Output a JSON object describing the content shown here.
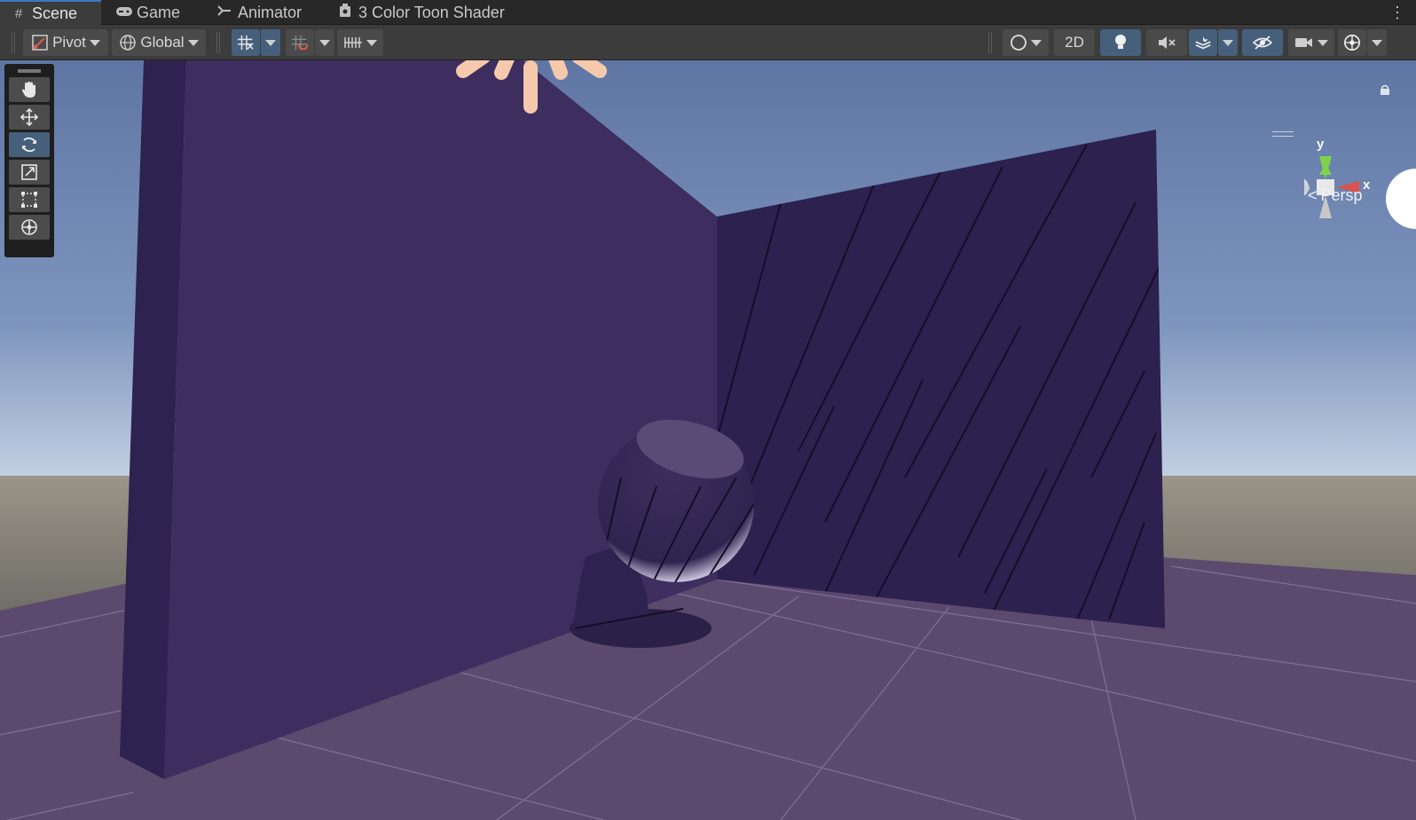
{
  "tabs": [
    {
      "label": "Scene",
      "icon": "scene-grid-icon",
      "active": true
    },
    {
      "label": "Game",
      "icon": "gamepad-icon",
      "active": false
    },
    {
      "label": "Animator",
      "icon": "animator-icon",
      "active": false
    },
    {
      "label": "3 Color Toon Shader",
      "icon": "shader-graph-icon",
      "active": false
    }
  ],
  "toolbar": {
    "pivot_label": "Pivot",
    "global_label": "Global",
    "mode_2d_label": "2D"
  },
  "tools": [
    {
      "name": "hand-tool",
      "icon": "hand-icon",
      "active": false
    },
    {
      "name": "move-tool",
      "icon": "move-arrows-icon",
      "active": false
    },
    {
      "name": "rotate-tool",
      "icon": "rotate-icon",
      "active": true
    },
    {
      "name": "scale-tool",
      "icon": "scale-icon",
      "active": false
    },
    {
      "name": "rect-tool",
      "icon": "rect-transform-icon",
      "active": false
    },
    {
      "name": "transform-tool",
      "icon": "transform-icon",
      "active": false
    }
  ],
  "gizmo": {
    "y_label": "y",
    "x_label": "x",
    "projection_label": "Persp"
  },
  "colors": {
    "accent": "#3a79bb",
    "active_button": "#46607c",
    "sky_top": "#5f76a4",
    "sky_horizon": "#e8edf3",
    "wall": "#3d2e5e",
    "wall_side": "#2e2250",
    "floor": "#5b4a6e",
    "gizmo_y": "#7fd34a",
    "gizmo_x": "#d9534f"
  }
}
